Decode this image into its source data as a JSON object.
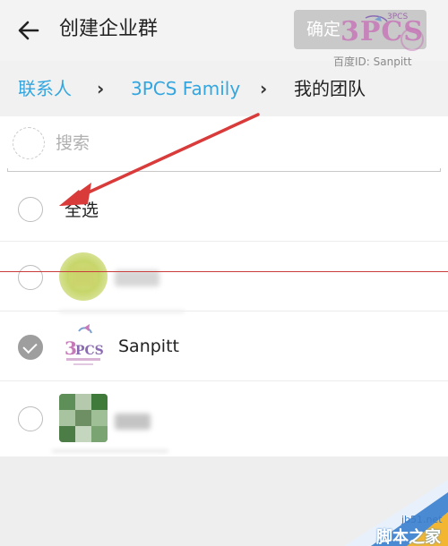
{
  "header": {
    "title": "创建企业群",
    "confirm_label": "确定"
  },
  "watermark": {
    "logo_text": "3PCS",
    "logo_small": "3PCS",
    "baidu_id": "百度ID: Sanpitt",
    "site": "jb51.net",
    "site_cn": "脚本之家"
  },
  "breadcrumb": {
    "items": [
      "联系人",
      "3PCS Family",
      "我的团队"
    ]
  },
  "search": {
    "placeholder": "搜索"
  },
  "select_all": {
    "label": "全选",
    "checked": false
  },
  "contacts": [
    {
      "name": "",
      "checked": false,
      "name_obscured": true
    },
    {
      "name": "Sanpitt",
      "checked": true,
      "name_obscured": false
    },
    {
      "name": "",
      "checked": false,
      "name_obscured": true
    }
  ],
  "colors": {
    "link": "#33a6e0",
    "annotation": "#d93a3a",
    "checked_radio": "#9e9e9e",
    "confirm_disabled": "#c9c9c9"
  }
}
